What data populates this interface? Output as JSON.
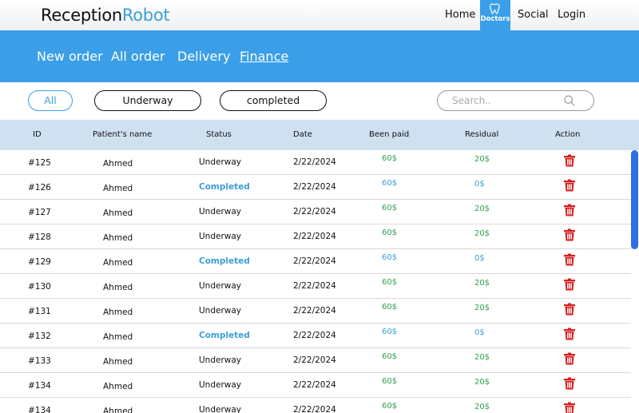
{
  "brand": {
    "part1": "Reception",
    "part2": "Robot"
  },
  "topnav": {
    "home": "Home",
    "doctors": "Doctors",
    "social": "Social",
    "login": "Login"
  },
  "tabs": {
    "new_order": "New order",
    "all_order": "All order",
    "delivery": "Delivery",
    "finance": "Finance"
  },
  "filters": {
    "all": "All",
    "underway": "Underway",
    "completed": "completed"
  },
  "search": {
    "placeholder": "Search.."
  },
  "table": {
    "headers": {
      "id": "ID",
      "name": "Patient's name",
      "status": "Status",
      "date": "Date",
      "paid": "Been paid",
      "residual": "Residual",
      "action": "Action"
    },
    "rows": [
      {
        "id": "#125",
        "name": "Ahmed",
        "status": "Underway",
        "date": "2/22/2024",
        "paid": "60$",
        "residual": "20$"
      },
      {
        "id": "#126",
        "name": "Ahmed",
        "status": "Completed",
        "date": "2/22/2024",
        "paid": "60$",
        "residual": "0$"
      },
      {
        "id": "#127",
        "name": "Ahmed",
        "status": "Underway",
        "date": "2/22/2024",
        "paid": "60$",
        "residual": "20$"
      },
      {
        "id": "#128",
        "name": "Ahmed",
        "status": "Underway",
        "date": "2/22/2024",
        "paid": "60$",
        "residual": "20$"
      },
      {
        "id": "#129",
        "name": "Ahmed",
        "status": "Completed",
        "date": "2/22/2024",
        "paid": "60$",
        "residual": "0$"
      },
      {
        "id": "#130",
        "name": "Ahmed",
        "status": "Underway",
        "date": "2/22/2024",
        "paid": "60$",
        "residual": "20$"
      },
      {
        "id": "#131",
        "name": "Ahmed",
        "status": "Underway",
        "date": "2/22/2024",
        "paid": "60$",
        "residual": "20$"
      },
      {
        "id": "#132",
        "name": "Ahmed",
        "status": "Completed",
        "date": "2/22/2024",
        "paid": "60$",
        "residual": "0$"
      },
      {
        "id": "#133",
        "name": "Ahmed",
        "status": "Underway",
        "date": "2/22/2024",
        "paid": "60$",
        "residual": "20$"
      },
      {
        "id": "#134",
        "name": "Ahmed",
        "status": "Underway",
        "date": "2/22/2024",
        "paid": "60$",
        "residual": "20$"
      },
      {
        "id": "#134",
        "name": "Ahmed",
        "status": "Underway",
        "date": "2/22/2024",
        "paid": "60$",
        "residual": "20$"
      }
    ]
  },
  "colors": {
    "primary": "#3a9fe8",
    "paid_green": "#2fa24a",
    "completed_blue": "#3a9fd6",
    "delete_red": "#d81e1e",
    "header_bg": "#cfe1f1"
  },
  "icons": {
    "doctors": "tooth-icon",
    "search": "search-icon",
    "delete": "trash-icon"
  }
}
